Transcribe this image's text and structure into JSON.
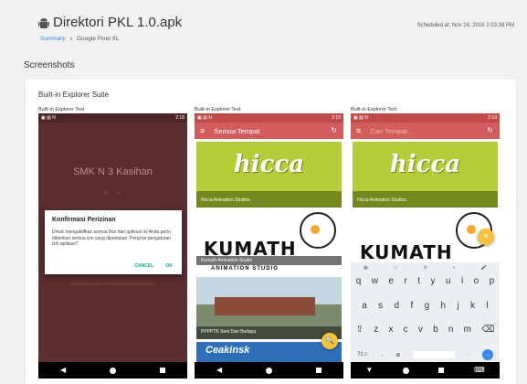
{
  "header": {
    "title": "Direktori PKL 1.0.apk",
    "breadcrumb": {
      "summary": "Summary",
      "device": "Google Pixel XL"
    },
    "scheduled": "Scheduled at: Nov 24, 2016 2:03:38 PM"
  },
  "section_title": "Screenshots",
  "suite": {
    "title": "Built-in Explorer Suite",
    "shot_label": "Built-in Explorer Test"
  },
  "phone1": {
    "time": "2:18",
    "school_name": "SMK N 3 Kasihan",
    "dialog_title": "Konfirmasi Perizinan",
    "dialog_message": "Untuk mengaktifkan semua fitur dari aplikasi ini Anda perlu diberikan semua izin yang diperlukan. Pergi ke pengaturan izin aplikasi?",
    "cancel_label": "CANCEL",
    "ok_label": "OK",
    "footer_note": "Aplikasi Direktori Tempat Praktik Kerja Industri"
  },
  "phone2": {
    "time": "2:19",
    "appbar_title": "Semua Tempat",
    "tiles": [
      "Hicca Animation Studios",
      "Kumath Animation Studio",
      "PPPPTK Seni Dan Budaya"
    ]
  },
  "phone3": {
    "time": "2:19",
    "search_placeholder": "Cari Tempat...",
    "tile": "Hicca Animation Studios",
    "keyboard_rows": [
      [
        "q",
        "w",
        "e",
        "r",
        "t",
        "y",
        "u",
        "i",
        "o",
        "p"
      ],
      [
        "a",
        "s",
        "d",
        "f",
        "g",
        "h",
        "j",
        "k",
        "l"
      ],
      [
        "⇧",
        "z",
        "x",
        "c",
        "v",
        "b",
        "n",
        "m",
        "⌫"
      ]
    ],
    "kb_numbers": "?1☺",
    "kb_comma": ",",
    "kb_period": "."
  },
  "icons": {
    "brand": "android-icon",
    "accent": "#d35c5c"
  }
}
